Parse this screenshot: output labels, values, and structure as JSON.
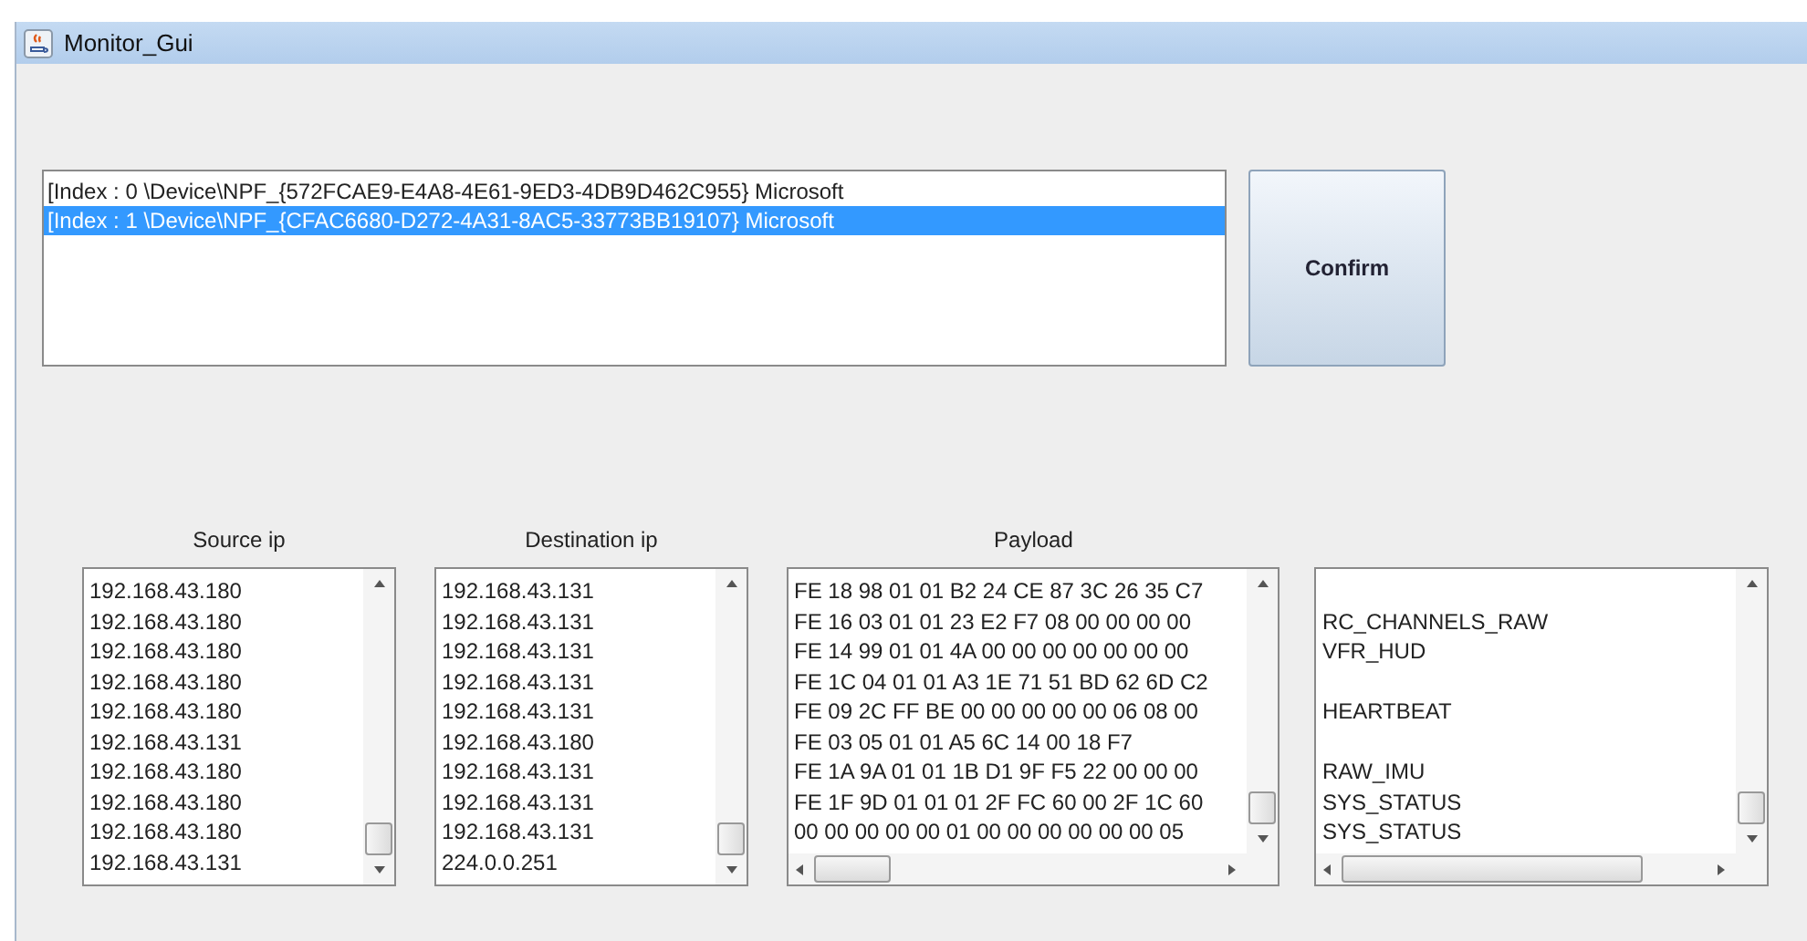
{
  "window": {
    "title": "Monitor_Gui"
  },
  "devices": [
    {
      "label": "[Index : 0 \\Device\\NPF_{572FCAE9-E4A8-4E61-9ED3-4DB9D462C955} Microsoft",
      "selected": false
    },
    {
      "label": "[Index : 1 \\Device\\NPF_{CFAC6680-D272-4A31-8AC5-33773BB19107} Microsoft",
      "selected": true
    }
  ],
  "confirm_button": "Confirm",
  "source_ip": {
    "heading": "Source ip",
    "rows": [
      "192.168.43.180",
      "192.168.43.180",
      "192.168.43.180",
      "192.168.43.180",
      "192.168.43.180",
      "192.168.43.131",
      "192.168.43.180",
      "192.168.43.180",
      "192.168.43.180",
      "192.168.43.131"
    ]
  },
  "destination_ip": {
    "heading": "Destination ip",
    "rows": [
      "192.168.43.131",
      "192.168.43.131",
      "192.168.43.131",
      "192.168.43.131",
      "192.168.43.131",
      "192.168.43.180",
      "192.168.43.131",
      "192.168.43.131",
      "192.168.43.131",
      "224.0.0.251"
    ]
  },
  "payload": {
    "heading": "Payload",
    "rows": [
      "FE 18 98 01 01 B2 24 CE 87 3C 26 35 C7",
      "FE 16 03 01 01 23 E2 F7 08 00 00 00 00",
      "FE 14 99 01 01 4A 00 00 00 00 00 00 00",
      "FE 1C 04 01 01 A3 1E 71 51 BD 62 6D C2",
      "FE 09 2C FF BE 00 00 00 00 00 06 08 00",
      "FE 03 05 01 01 A5 6C 14 00 18 F7",
      "FE 1A 9A 01 01 1B D1 9F F5 22 00 00 00",
      "FE 1F 9D 01 01 01 2F FC 60 00 2F 1C 60",
      "00 00 00 00 00 01 00 00 00 00 00 00 05"
    ]
  },
  "messages": {
    "rows": [
      {
        "text": "RC_CHANNELS_RAW",
        "gap_before": true
      },
      {
        "text": "VFR_HUD",
        "gap_before": false
      },
      {
        "text": "HEARTBEAT",
        "gap_before": true
      },
      {
        "text": "RAW_IMU",
        "gap_before": true
      },
      {
        "text": "SYS_STATUS",
        "gap_before": false
      },
      {
        "text": "SYS_STATUS",
        "gap_before": false
      }
    ]
  }
}
